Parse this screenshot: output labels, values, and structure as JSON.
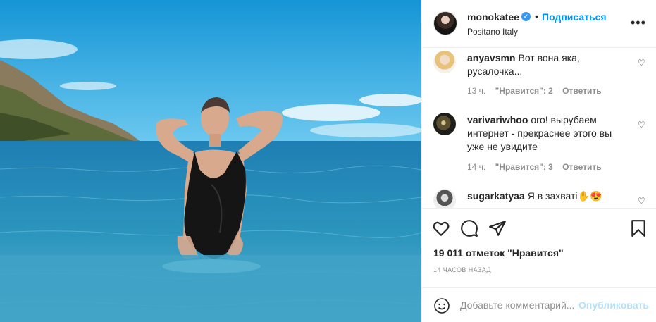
{
  "post": {
    "username": "monokatee",
    "follow_label": "Подписаться",
    "location": "Positano Italy",
    "likes_text": "19 011 отметок \"Нравится\"",
    "time_ago": "14 ЧАСОВ НАЗАД"
  },
  "comments": [
    {
      "username": "anyavsmn",
      "text": "Вот вона яка, русалочка...",
      "time": "13 ч.",
      "likes": "\"Нравится\": 2",
      "reply": "Ответить"
    },
    {
      "username": "varivariwhoo",
      "text": "ого! вырубаем интернет - прекраснее этого вы уже не увидите",
      "time": "14 ч.",
      "likes": "\"Нравится\": 3",
      "reply": "Ответить"
    },
    {
      "username": "sugarkatyaa",
      "text": "Я в захваті✋😍"
    }
  ],
  "add_comment": {
    "placeholder": "Добавьте комментарий...",
    "publish_label": "Опубликовать"
  },
  "icons": {
    "verified": "verified-badge-icon",
    "more": "more-options-icon",
    "like": "heart-icon",
    "comment": "comment-bubble-icon",
    "share": "paper-plane-icon",
    "save": "bookmark-icon",
    "emoji": "emoji-smile-icon"
  },
  "colors": {
    "link_blue": "#0095f6",
    "publish_disabled": "#b2dffc",
    "verified_blue": "#3897f0"
  }
}
